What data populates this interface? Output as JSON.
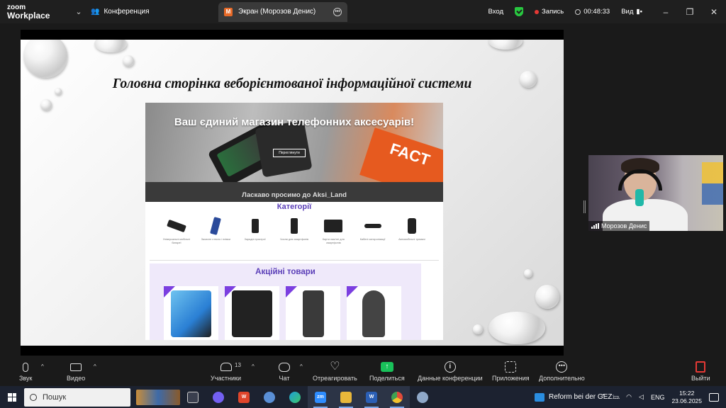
{
  "titlebar": {
    "brand_top": "zoom",
    "brand_bottom": "Workplace",
    "conference_label": "Конференция",
    "tab_label": "Экран (Морозов Денис)",
    "tab_initial": "M",
    "login_label": "Вход",
    "recording_label": "Запись",
    "timer": "00:48:33",
    "view_label": "Вид",
    "minimize": "–",
    "restore": "❐",
    "close": "✕"
  },
  "slide": {
    "title": "Головна сторінка веборієнтованої інформаційної системи",
    "site": {
      "hero_title": "Ваш єдиний магазин телефонних аксесуарів!",
      "hero_button": "Переглянути",
      "hero_book_text": "FACT",
      "welcome": "Ласкаво просимо до Aksi_Land",
      "categories_title": "Категорії",
      "categories": [
        {
          "icon": "powerbank-icon",
          "label": "Універсальні мобільні батареї"
        },
        {
          "icon": "screen-protector-icon",
          "label": "Захисне стекло і плівки"
        },
        {
          "icon": "charger-icon",
          "label": "Зарядні пристрої"
        },
        {
          "icon": "phone-case-icon",
          "label": "Чохли для смартфонів"
        },
        {
          "icon": "memory-card-icon",
          "label": "Карти пам'яті для смартфонів"
        },
        {
          "icon": "cable-icon",
          "label": "Кабелі синхронізації"
        },
        {
          "icon": "car-holder-icon",
          "label": "Автомобільні тримачі"
        }
      ],
      "promo_title": "Акційні товари",
      "promo_products": [
        {
          "name": "screen-protector-product",
          "color": "#2a7fd4"
        },
        {
          "name": "phone-case-product",
          "color": "#222222"
        },
        {
          "name": "powerbank-product",
          "color": "#3a3a3a"
        },
        {
          "name": "car-holder-product",
          "color": "#444444"
        }
      ]
    }
  },
  "participant": {
    "name": "Морозов Денис"
  },
  "toolbar": {
    "audio": "Звук",
    "video": "Видео",
    "participants": "Участники",
    "participants_count": "13",
    "chat": "Чат",
    "react": "Отреагировать",
    "share": "Поделиться",
    "info": "Данные конференции",
    "apps": "Приложения",
    "more": "Дополнительно",
    "leave": "Выйти",
    "caret": "^"
  },
  "taskbar": {
    "search_label": "Пошук",
    "notice": "Reform bei der GEZ:...",
    "language": "ENG",
    "time": "15:22",
    "date": "23.06.2025",
    "apps": [
      {
        "name": "task-view-icon",
        "color": "#3a3f4e",
        "active": false
      },
      {
        "name": "viber-icon",
        "color": "#7360f2",
        "active": false
      },
      {
        "name": "wps-office-icon",
        "color": "#e0452b",
        "active": false
      },
      {
        "name": "paint-icon",
        "color": "#5a8fd6",
        "active": false
      },
      {
        "name": "edge-icon",
        "color": "#1fa0d8",
        "active": false
      },
      {
        "name": "zoom-app-icon",
        "color": "#2d8cff",
        "active": true
      },
      {
        "name": "file-explorer-icon",
        "color": "#e8b73a",
        "active": true
      },
      {
        "name": "word-icon",
        "color": "#2b5fb5",
        "active": true
      },
      {
        "name": "chrome-icon",
        "color": "#3ea152",
        "active": true
      },
      {
        "name": "paint-brush-icon",
        "color": "#8fa8c8",
        "active": false
      }
    ]
  }
}
